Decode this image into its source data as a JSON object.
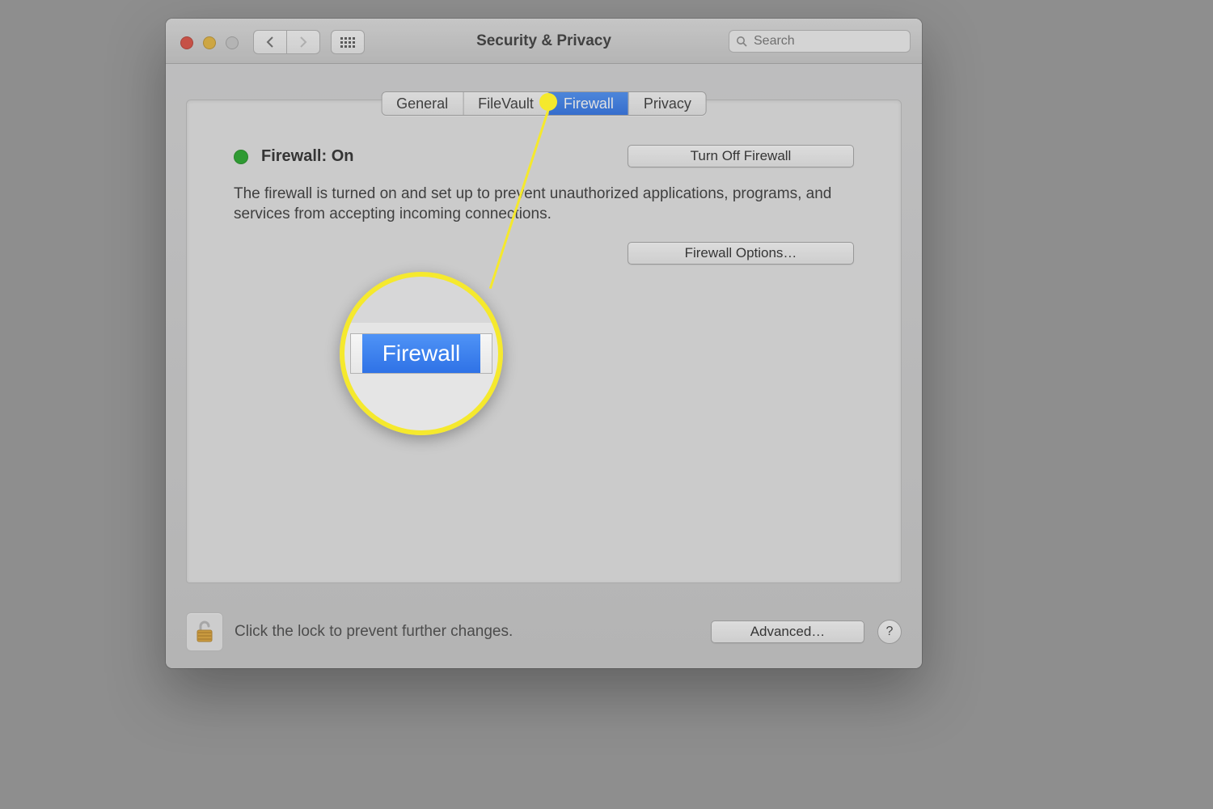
{
  "window": {
    "title": "Security & Privacy"
  },
  "search": {
    "placeholder": "Search"
  },
  "tabs": {
    "general": "General",
    "filevault": "FileVault",
    "firewall": "Firewall",
    "privacy": "Privacy",
    "active": "firewall"
  },
  "firewall": {
    "status_label": "Firewall: On",
    "status_color": "#27a92b",
    "description": "The firewall is turned on and set up to prevent unauthorized applications, programs, and services from accepting incoming connections.",
    "turn_off_label": "Turn Off Firewall",
    "options_label": "Firewall Options…"
  },
  "footer": {
    "lock_text": "Click the lock to prevent further changes.",
    "advanced_label": "Advanced…",
    "help_label": "?"
  },
  "annotation": {
    "magnifier_label": "Firewall",
    "highlight_color": "#f5e92d"
  }
}
